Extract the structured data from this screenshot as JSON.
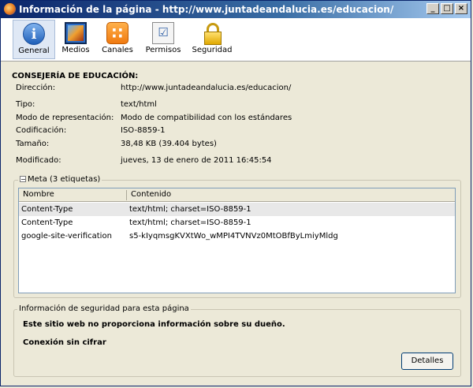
{
  "window": {
    "title": "Información de la página - http://www.juntadeandalucia.es/educacion/",
    "controls": [
      "_",
      "□",
      "×"
    ]
  },
  "toolbar": {
    "items": [
      {
        "label": "General",
        "icon": "info-icon",
        "active": true
      },
      {
        "label": "Medios",
        "icon": "media-icon",
        "active": false
      },
      {
        "label": "Canales",
        "icon": "rss-icon",
        "active": false
      },
      {
        "label": "Permisos",
        "icon": "permissions-icon",
        "active": false
      },
      {
        "label": "Seguridad",
        "icon": "padlock-icon",
        "active": false
      }
    ]
  },
  "general": {
    "page_title": "CONSEJERÍA DE EDUCACIÓN:",
    "address": {
      "label": "Dirección:",
      "value": "http://www.juntadeandalucia.es/educacion/"
    },
    "type": {
      "label": "Tipo:",
      "value": "text/html"
    },
    "render_mode": {
      "label": "Modo de representación:",
      "value": "Modo de compatibilidad con los estándares"
    },
    "encoding": {
      "label": "Codificación:",
      "value": "ISO-8859-1"
    },
    "size": {
      "label": "Tamaño:",
      "value": "38,48 KB (39.404 bytes)"
    },
    "modified": {
      "label": "Modificado:",
      "value": "jueves, 13 de enero de 2011 16:45:54"
    }
  },
  "meta": {
    "legend": "Meta (3 etiquetas)",
    "toggle": "−",
    "columns": [
      "Nombre",
      "Contenido"
    ],
    "rows": [
      {
        "name": "Content-Type",
        "content": "text/html; charset=ISO-8859-1"
      },
      {
        "name": "Content-Type",
        "content": "text/html; charset=ISO-8859-1"
      },
      {
        "name": "google-site-verification",
        "content": "s5-kIyqmsgKVXtWo_wMPI4TVNVz0MtOBfByLmiyMldg"
      }
    ]
  },
  "security": {
    "legend": "Información de seguridad para esta página",
    "owner": "Este sitio web no proporciona información sobre su dueño.",
    "connection": "Conexión sin cifrar",
    "details_button": "Detalles"
  }
}
